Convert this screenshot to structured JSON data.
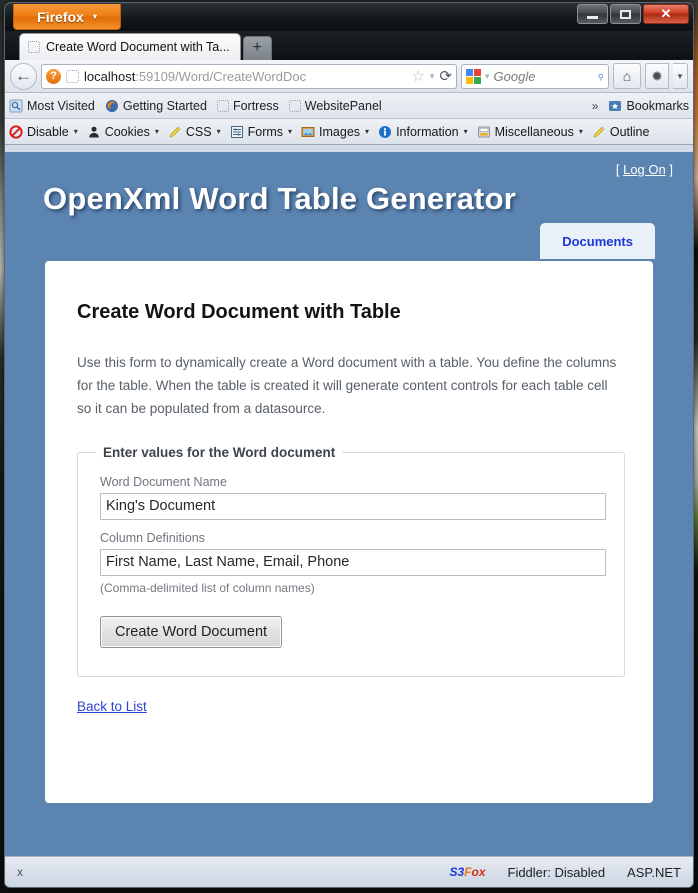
{
  "browser": {
    "app_button": "Firefox",
    "app_button_caret": "▾",
    "window_controls": {
      "minimize": "minimize-icon",
      "maximize": "maximize-icon",
      "close": "✕"
    },
    "tab": {
      "title": "Create Word Document with Ta...",
      "favicon": "blank-favicon-icon"
    },
    "new_tab_label": "+",
    "back_label": "←",
    "url": {
      "host": "localhost",
      "rest": ":59109/Word/CreateWordDoc"
    },
    "url_icons": {
      "identity": "?",
      "favicon": "blank-favicon-icon",
      "star": "☆",
      "caret": "▾",
      "reload": "⟳"
    },
    "search": {
      "engine": "google-icon",
      "placeholder": "Google",
      "caret": "▾",
      "magnifier": "⌕"
    },
    "toolbar_icons": {
      "home": "⌂",
      "addon": "✹",
      "overflow_caret": "▾"
    }
  },
  "bookmarks_bar": {
    "items": [
      {
        "label": "Most Visited",
        "icon": "most-visited-icon"
      },
      {
        "label": "Getting Started",
        "icon": "firefox-icon"
      },
      {
        "label": "Fortress",
        "icon": "blank-favicon-icon"
      },
      {
        "label": "WebsitePanel",
        "icon": "blank-favicon-icon"
      }
    ],
    "overflow": "»",
    "bookmarks_label": "Bookmarks",
    "bookmarks_icon": "star-folder-icon"
  },
  "dev_toolbar": {
    "items": [
      {
        "label": "Disable",
        "icon": "disable-icon",
        "caret": "▾"
      },
      {
        "label": "Cookies",
        "icon": "cookies-person-icon",
        "caret": "▾"
      },
      {
        "label": "CSS",
        "icon": "css-pencil-icon",
        "caret": "▾"
      },
      {
        "label": "Forms",
        "icon": "forms-icon",
        "caret": "▾"
      },
      {
        "label": "Images",
        "icon": "images-icon",
        "caret": "▾"
      },
      {
        "label": "Information",
        "icon": "information-icon",
        "caret": "▾"
      },
      {
        "label": "Miscellaneous",
        "icon": "miscellaneous-icon",
        "caret": "▾"
      },
      {
        "label": "Outline",
        "icon": "outline-pencil-icon",
        "caret": ""
      }
    ]
  },
  "page": {
    "log_on_prefix": "[",
    "log_on_label": "Log On",
    "log_on_suffix": "]",
    "site_title": "OpenXml Word Table Generator",
    "nav_tab": "Documents",
    "heading": "Create Word Document with Table",
    "description": "Use this form to dynamically create a Word document with a table. You define the columns for the table. When the table is created it will generate content controls for each table cell so it can be populated from a datasource.",
    "fieldset_legend": "Enter values for the Word document",
    "fields": [
      {
        "label": "Word Document Name",
        "value": "King's Document",
        "placeholder": "",
        "hint": ""
      },
      {
        "label": "Column Definitions",
        "value": "First Name, Last Name, Email, Phone",
        "placeholder": "",
        "hint": "(Comma-delimited list of column names)"
      }
    ],
    "submit_label": "Create Word Document",
    "back_link": "Back to List",
    "colors": {
      "page_background": "#5b84b1",
      "panel_background": "#ffffff",
      "tab_text": "#1b39d6",
      "link": "#2b45d4"
    }
  },
  "status_bar": {
    "close_glyph": "x",
    "s3fox": {
      "part1": "S3",
      "part2": "F",
      "part3": "ox"
    },
    "fiddler": "Fiddler: Disabled",
    "aspnet": "ASP.NET"
  }
}
